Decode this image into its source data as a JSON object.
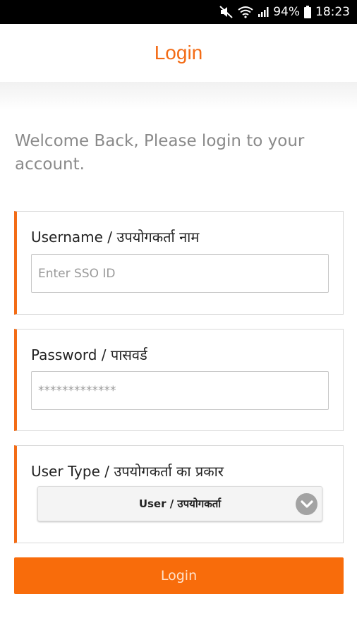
{
  "status_bar": {
    "battery": "94%",
    "time": "18:23",
    "icons": [
      "mute-icon",
      "wifi-icon",
      "signal-icon",
      "battery-icon"
    ]
  },
  "header": {
    "title": "Login",
    "accent_color": "#f36c16"
  },
  "welcome_text": "Welcome Back, Please login to your account.",
  "form": {
    "username": {
      "label": "Username / उपयोगकर्ता नाम",
      "placeholder": "Enter SSO ID",
      "value": ""
    },
    "password": {
      "label": "Password / पासवर्ड",
      "placeholder": "*************",
      "value": ""
    },
    "user_type": {
      "label": "User Type / उपयोगकर्ता का प्रकार",
      "selected": "User / उपयोगकर्ता",
      "icon": "chevron-down-icon"
    }
  },
  "login_button": {
    "label": "Login",
    "color": "#f86c0b"
  }
}
